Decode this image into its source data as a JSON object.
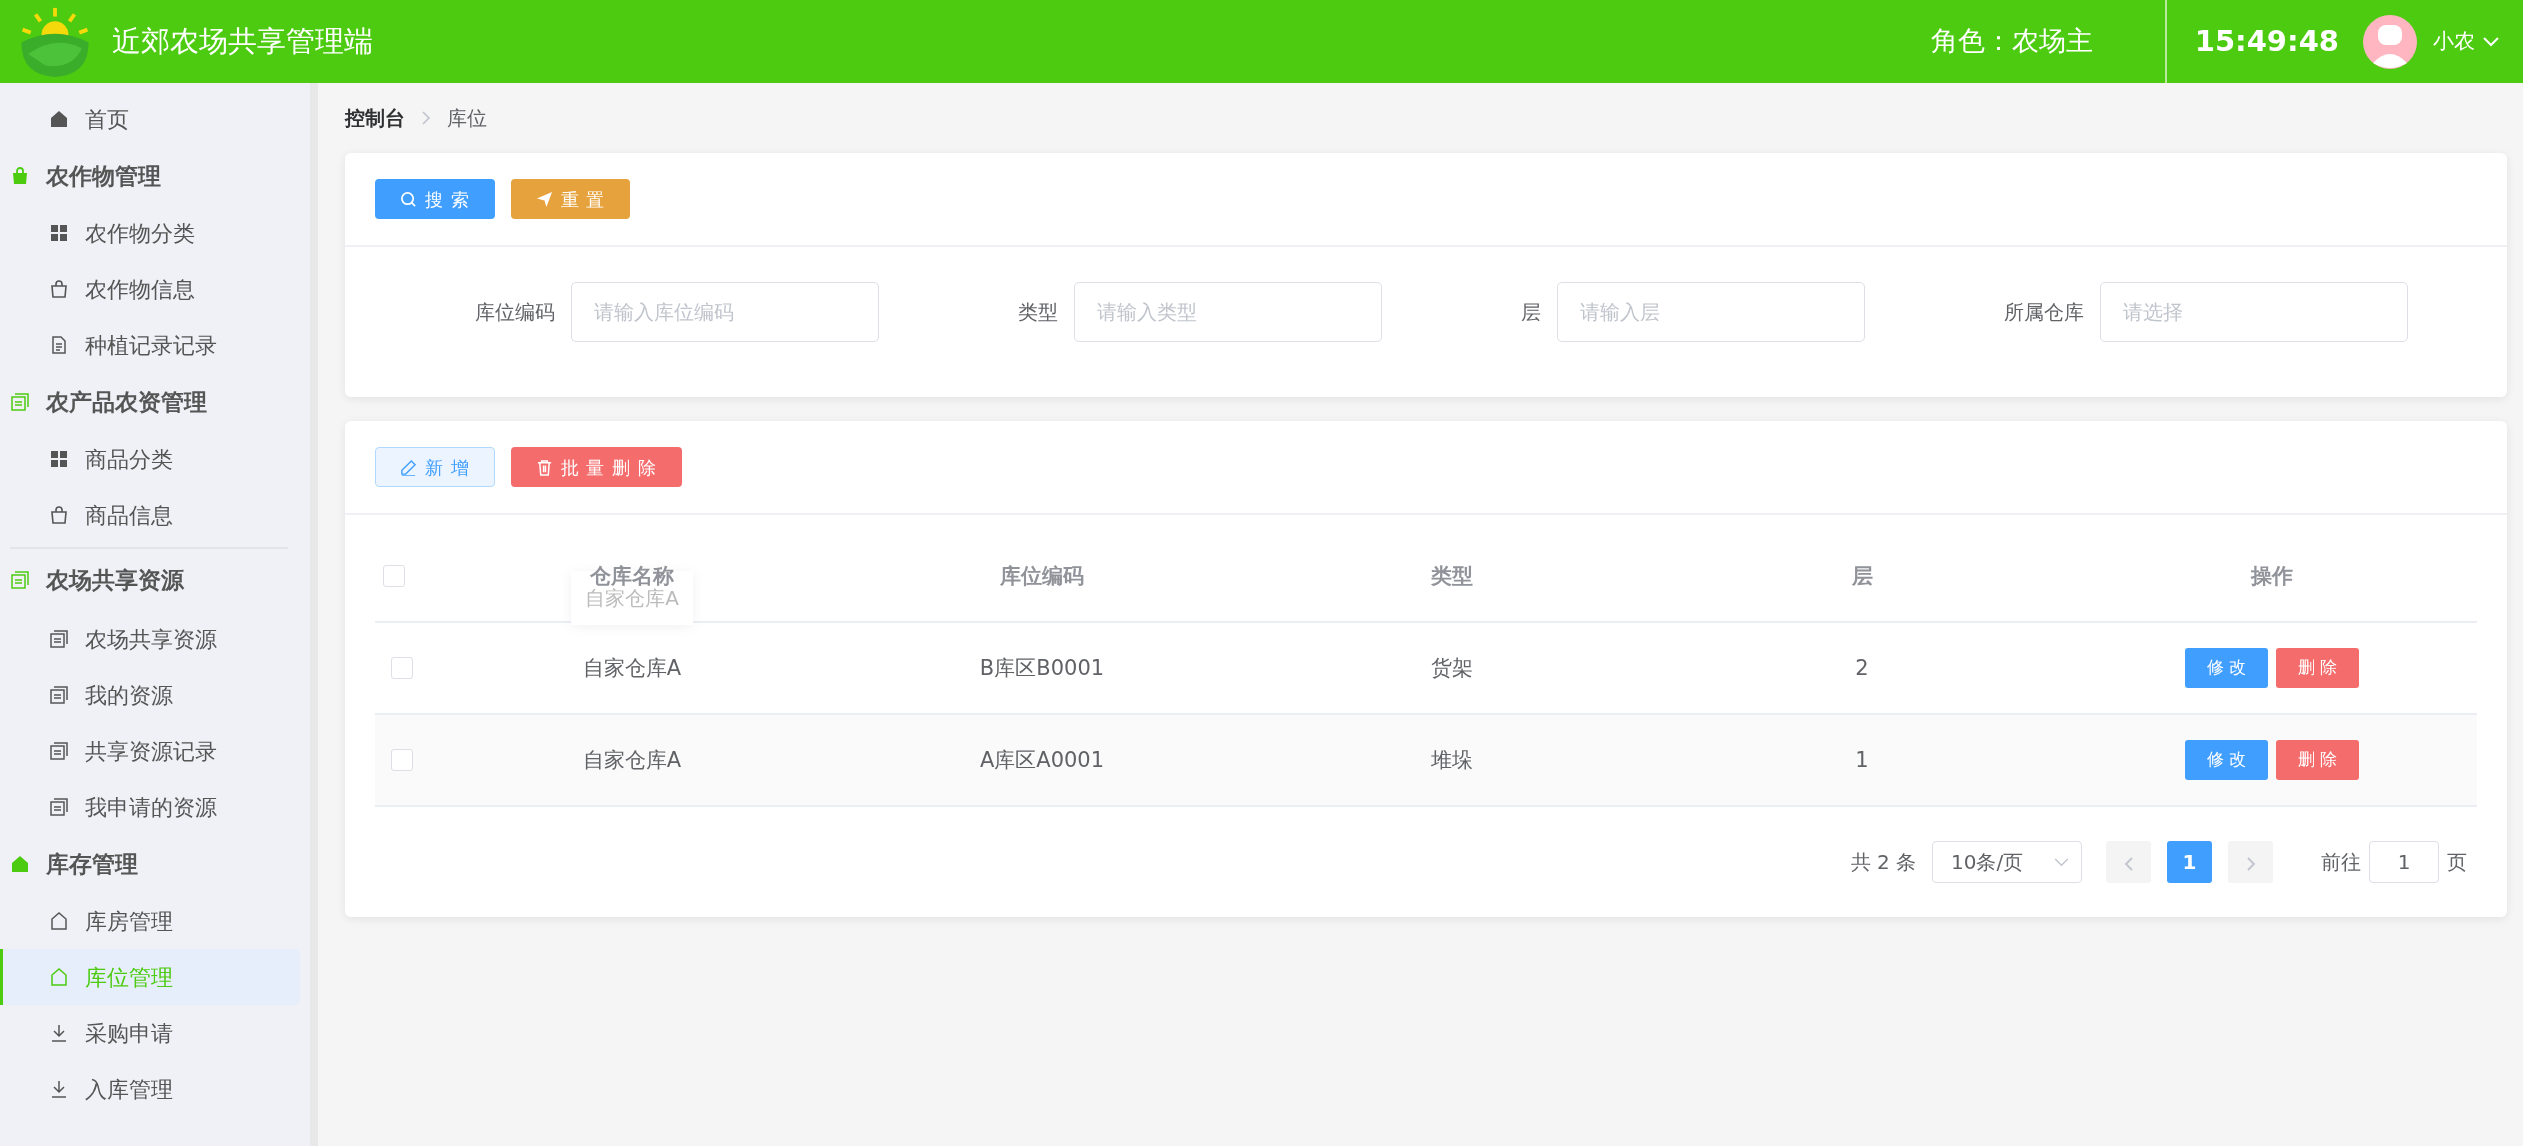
{
  "header": {
    "title": "近郊农场共享管理端",
    "role": "角色：农场主",
    "time": "15:49:48",
    "user": "小农"
  },
  "sidebar": [
    {
      "kind": "home",
      "label": "首页",
      "selected": false
    },
    {
      "kind": "bag",
      "label": "农作物管理",
      "separator": false,
      "children": [
        {
          "kind": "grid",
          "label": "农作物分类",
          "selected": false
        },
        {
          "kind": "bag",
          "label": "农作物信息",
          "selected": false
        },
        {
          "kind": "doc",
          "label": "种植记录记录",
          "selected": false
        }
      ]
    },
    {
      "kind": "stack",
      "label": "农产品农资管理",
      "separator": false,
      "children": [
        {
          "kind": "grid",
          "label": "商品分类",
          "selected": false
        },
        {
          "kind": "bag",
          "label": "商品信息",
          "selected": false
        }
      ]
    },
    {
      "kind": "stack",
      "label": "农场共享资源",
      "separator": true,
      "children": [
        {
          "kind": "stack",
          "label": "农场共享资源",
          "selected": false
        },
        {
          "kind": "stack",
          "label": "我的资源",
          "selected": false
        },
        {
          "kind": "stack",
          "label": "共享资源记录",
          "selected": false
        },
        {
          "kind": "stack",
          "label": "我申请的资源",
          "selected": false
        }
      ]
    },
    {
      "kind": "home",
      "label": "库存管理",
      "separator": false,
      "children": [
        {
          "kind": "house",
          "label": "库房管理",
          "selected": false
        },
        {
          "kind": "house",
          "label": "库位管理",
          "selected": true
        },
        {
          "kind": "download",
          "label": "采购申请",
          "selected": false
        },
        {
          "kind": "download",
          "label": "入库管理",
          "selected": false
        }
      ]
    }
  ],
  "breadcrumb": [
    "控制台",
    "库位"
  ],
  "search_buttons": [
    {
      "kind": "search",
      "label": "搜 索"
    },
    {
      "kind": "reset",
      "label": "重 置"
    }
  ],
  "filters": [
    {
      "label": "库位编码",
      "placeholder": "请输入库位编码"
    },
    {
      "label": "类型",
      "placeholder": "请输入类型"
    },
    {
      "label": "层",
      "placeholder": "请输入层"
    },
    {
      "label": "所属仓库",
      "placeholder": "请选择"
    }
  ],
  "table_buttons": [
    {
      "kind": "add",
      "label": "新 增"
    },
    {
      "kind": "delete",
      "label": "批 量 删 除"
    }
  ],
  "table": {
    "select_all": {
      "checked": false
    },
    "columns": [
      "仓库名称",
      "库位编码",
      "类型",
      "层",
      "操作"
    ],
    "rows": [
      {
        "checked": false,
        "cells": [
          "自家仓库A",
          "B库区B0001",
          "货架",
          "2"
        ],
        "actions": [
          {
            "kind": "edit",
            "label": "修 改"
          },
          {
            "kind": "delete",
            "label": "删 除"
          }
        ]
      },
      {
        "checked": false,
        "cells": [
          "自家仓库A",
          "A库区A0001",
          "堆垛",
          "1"
        ],
        "actions": [
          {
            "kind": "edit",
            "label": "修 改"
          },
          {
            "kind": "delete",
            "label": "删 除"
          }
        ]
      }
    ]
  },
  "tooltip": {
    "text": "自家仓库A"
  },
  "pagination": {
    "total": "共 2 条",
    "page_size": "10条/页",
    "pages": [
      {
        "label": "1",
        "selected": true
      }
    ],
    "goto_label": "前往",
    "goto_value": "1",
    "goto_suffix": "页"
  }
}
